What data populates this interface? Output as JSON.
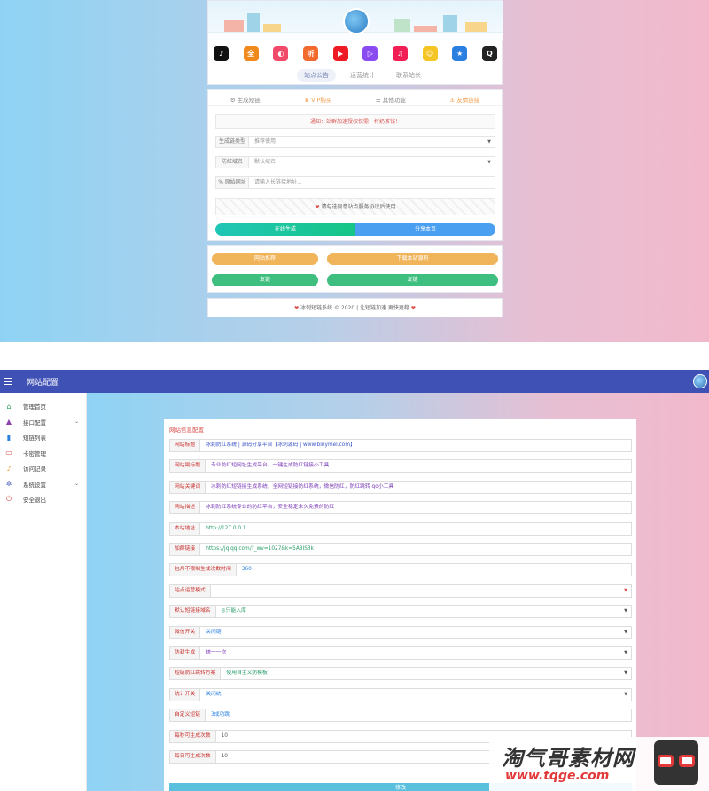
{
  "front": {
    "apps": [
      {
        "icon": "douyin-icon",
        "glyph": "♪",
        "color": "#111111"
      },
      {
        "icon": "quanmin-icon",
        "glyph": "全",
        "color": "#f08a1c"
      },
      {
        "icon": "weishi-icon",
        "glyph": "◐",
        "color": "#f24a6a"
      },
      {
        "icon": "ting-icon",
        "glyph": "听",
        "color": "#f36a2e"
      },
      {
        "icon": "youtube-icon",
        "glyph": "▶",
        "color": "#ee1b24"
      },
      {
        "icon": "video-icon",
        "glyph": "▷",
        "color": "#8a4bf0"
      },
      {
        "icon": "music-icon",
        "glyph": "♫",
        "color": "#f21f55"
      },
      {
        "icon": "emoji-icon",
        "glyph": "☺",
        "color": "#f5c524"
      },
      {
        "icon": "star-icon",
        "glyph": "★",
        "color": "#2a7fe0"
      },
      {
        "icon": "qq-icon",
        "glyph": "Q",
        "color": "#222222"
      }
    ],
    "tabs": [
      "站点公告",
      "运营统计",
      "联系站长"
    ],
    "nav": [
      "生成短链",
      "VIP购买",
      "其他功能",
      "友情链接"
    ],
    "notice": "通知：站群加速授权仅需一杯奶茶钱！",
    "fields": [
      {
        "label": "生成链类型",
        "value": "推荐使用",
        "select": true
      },
      {
        "label": "防红域名",
        "value": "默认域名",
        "select": true
      },
      {
        "label": "% 原始网址",
        "value": "请输入长链接地址...",
        "select": false
      }
    ],
    "agreement": "请勾选同意站点服务协议后使用",
    "btn_generate": "在线生成",
    "btn_share": "分享本页",
    "btn_share_site": "网站推荐",
    "btn_download": "下载本站源码",
    "btn_green_left": "友链",
    "btn_green_right": "友链",
    "footer": "冰刺短链系统 © 2020 | 让短链加速 更快更稳"
  },
  "admin": {
    "title": "网站配置",
    "sidebar": [
      {
        "label": "管理首页",
        "icon": "home-icon",
        "color": "#2e9e5b",
        "expandable": false
      },
      {
        "label": "接口配置",
        "icon": "arrow-icon",
        "color": "#8e44ad",
        "expandable": true
      },
      {
        "label": "短链列表",
        "icon": "book-icon",
        "color": "#2a7fe0",
        "expandable": false
      },
      {
        "label": "卡密管理",
        "icon": "card-icon",
        "color": "#d9534f",
        "expandable": false
      },
      {
        "label": "访问记录",
        "icon": "bell-icon",
        "color": "#f0a030",
        "expandable": false
      },
      {
        "label": "系统设置",
        "icon": "gear-icon",
        "color": "#3f51b5",
        "expandable": true
      },
      {
        "label": "安全退出",
        "icon": "power-icon",
        "color": "#d9534f",
        "expandable": false
      }
    ],
    "panel_title": "网站信息配置",
    "rows": [
      {
        "label": "网站标题",
        "value": "冰刺防红系统 | 源码分享平台【冰刺源码 | www.binymel.com】",
        "color": "#3a55c9",
        "select": false
      },
      {
        "label": "网站副标题",
        "value": "专业防红短网址生成平台，一键生成防红链接小工具",
        "color": "#7a3ab8",
        "select": false
      },
      {
        "label": "网站关键词",
        "value": "冰刺防红短链接生成系统，全网短链接防红系统，微信防红，防红跳转 qq小工具",
        "color": "#7a3ab8",
        "select": false
      },
      {
        "label": "网站描述",
        "value": "冰刺防红系统专业的防红平台，安全稳定永久免费的防红",
        "color": "#7a3ab8",
        "select": false
      },
      {
        "label": "本站地址",
        "value": "http://127.0.0.1",
        "color": "#2a9d6a",
        "select": false
      },
      {
        "label": "加群链接",
        "value": "https://jq.qq.com/?_wv=1027&k=5A8IS3k",
        "color": "#2a9d6a",
        "select": false
      },
      {
        "label": "包月不限制生成次数时间",
        "value": "360",
        "color": "#2a7fe0",
        "select": false
      },
      {
        "label": "站点运营模式",
        "value": "",
        "color": "#555555",
        "select": true
      },
      {
        "label": "默认短链接域名",
        "value": "◎只能入库",
        "color": "#2a9d6a",
        "select": true
      },
      {
        "label": "微信开关",
        "value": "关闭链",
        "color": "#2a7fe0",
        "select": true
      },
      {
        "label": "防封生成",
        "value": "统一一次",
        "color": "#7a3ab8",
        "select": true
      },
      {
        "label": "短链防红跳转方案",
        "value": "使用自主义防模板",
        "color": "#2a9d6a",
        "select": true
      },
      {
        "label": "统计开关",
        "value": "关闭统",
        "color": "#2a7fe0",
        "select": true
      },
      {
        "label": "自定义短链",
        "value": "3成功跳",
        "color": "#2a7fe0",
        "select": false
      },
      {
        "label": "每秒可生成次数",
        "value": "10",
        "color": "#555555",
        "select": false
      },
      {
        "label": "每日可生成次数",
        "value": "10",
        "color": "#555555",
        "select": false
      }
    ],
    "submit": "修改"
  },
  "watermark": {
    "main": "淘气哥素材网",
    "url": "www.tqge.com"
  }
}
